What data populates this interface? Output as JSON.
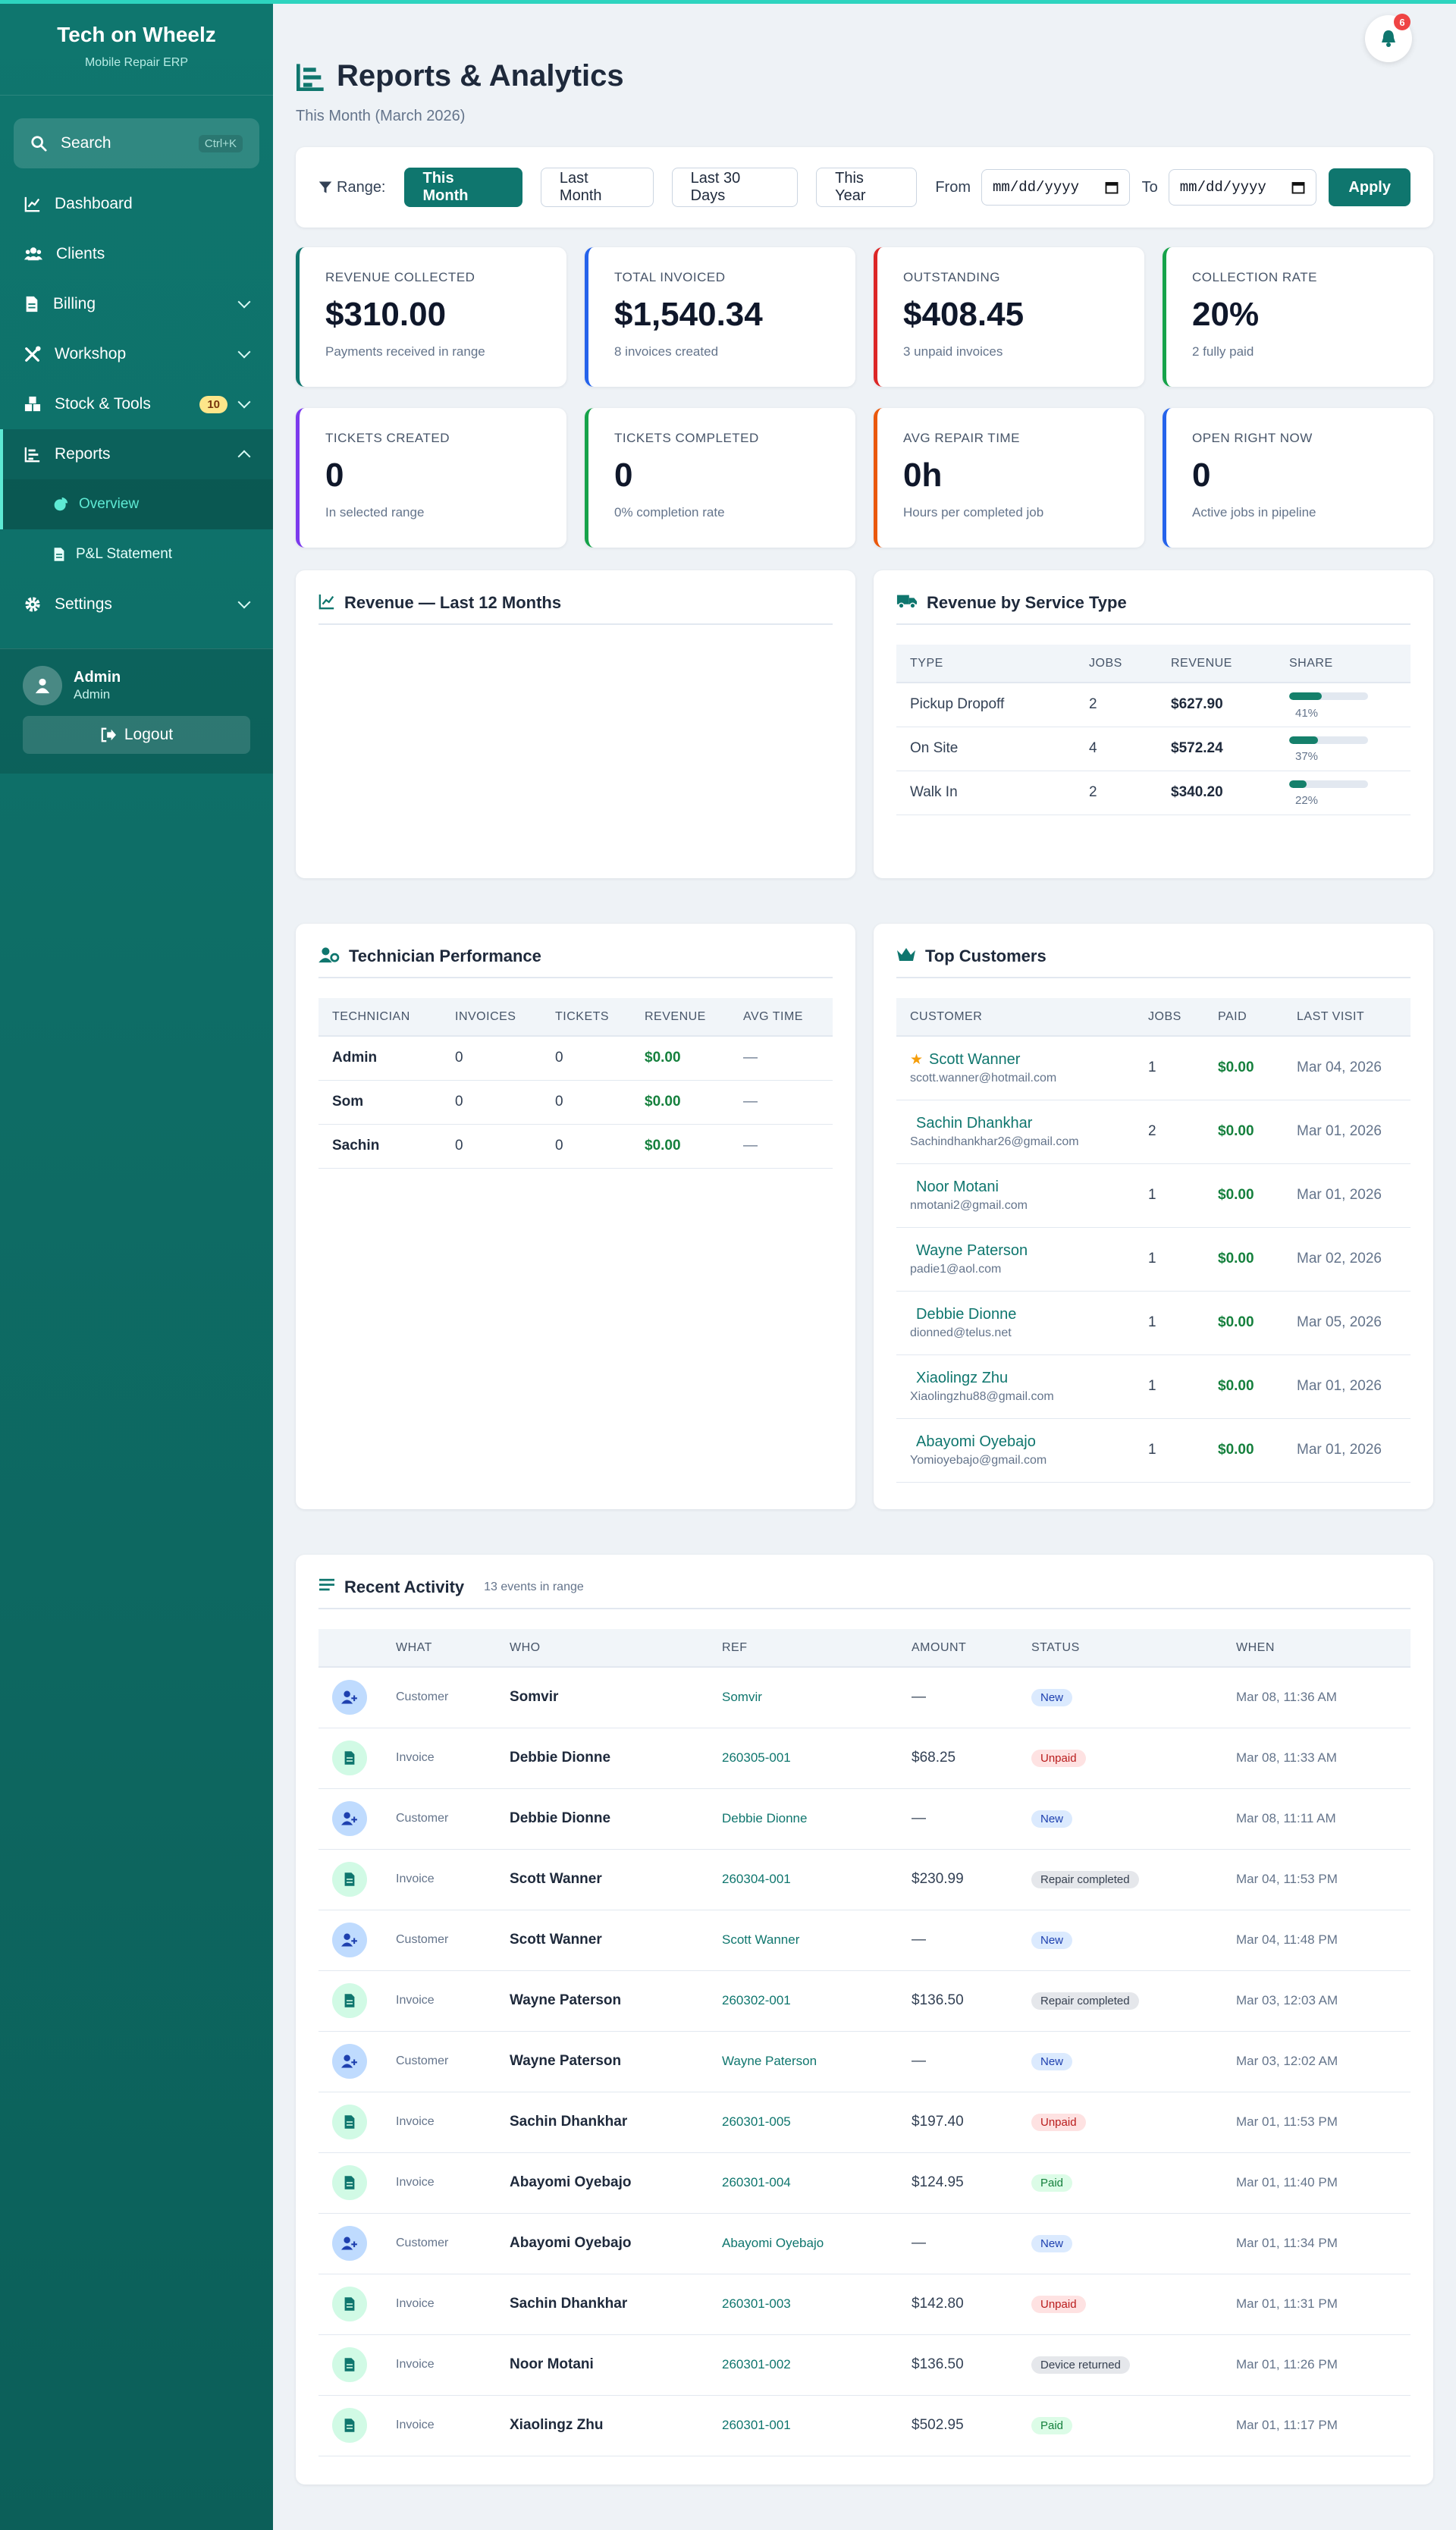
{
  "sidebar": {
    "brand_title": "Tech on Wheelz",
    "brand_sub": "Mobile Repair ERP",
    "search_label": "Search",
    "search_shortcut": "Ctrl+K",
    "nav": {
      "dashboard": "Dashboard",
      "clients": "Clients",
      "billing": "Billing",
      "workshop": "Workshop",
      "stock": "Stock & Tools",
      "stock_badge": "10",
      "reports": "Reports",
      "overview": "Overview",
      "pl": "P&L Statement",
      "settings": "Settings"
    },
    "user_name": "Admin",
    "user_role": "Admin",
    "logout": "Logout"
  },
  "header": {
    "title": "Reports & Analytics",
    "subtitle": "This Month (March 2026)",
    "bell_count": "6"
  },
  "filter": {
    "range_label": "Range:",
    "buttons": [
      "This Month",
      "Last Month",
      "Last 30 Days",
      "This Year"
    ],
    "active_button": "This Month",
    "from_label": "From",
    "to_label": "To",
    "date_placeholder": "mm/dd/yyyy",
    "apply": "Apply"
  },
  "stats": [
    {
      "label": "REVENUE COLLECTED",
      "value": "$310.00",
      "sub": "Payments received in range",
      "color": "#0f766e"
    },
    {
      "label": "TOTAL INVOICED",
      "value": "$1,540.34",
      "sub": "8 invoices created",
      "color": "#2563eb"
    },
    {
      "label": "OUTSTANDING",
      "value": "$408.45",
      "sub": "3 unpaid invoices",
      "color": "#dc2626"
    },
    {
      "label": "COLLECTION RATE",
      "value": "20%",
      "sub": "2 fully paid",
      "color": "#16a34a"
    },
    {
      "label": "TICKETS CREATED",
      "value": "0",
      "sub": "In selected range",
      "color": "#7c3aed"
    },
    {
      "label": "TICKETS COMPLETED",
      "value": "0",
      "sub": "0% completion rate",
      "color": "#16a34a"
    },
    {
      "label": "AVG REPAIR TIME",
      "value": "0h",
      "sub": "Hours per completed job",
      "color": "#ea580c"
    },
    {
      "label": "OPEN RIGHT NOW",
      "value": "0",
      "sub": "Active jobs in pipeline",
      "color": "#2563eb"
    }
  ],
  "revenue_chart": {
    "title": "Revenue — Last 12 Months"
  },
  "service": {
    "title": "Revenue by Service Type",
    "headers": [
      "TYPE",
      "JOBS",
      "REVENUE",
      "SHARE"
    ],
    "rows": [
      {
        "type": "Pickup Dropoff",
        "jobs": "2",
        "revenue": "$627.90",
        "share": "41%",
        "share_value": 41
      },
      {
        "type": "On Site",
        "jobs": "4",
        "revenue": "$572.24",
        "share": "37%",
        "share_value": 37
      },
      {
        "type": "Walk In",
        "jobs": "2",
        "revenue": "$340.20",
        "share": "22%",
        "share_value": 22
      }
    ]
  },
  "tech": {
    "title": "Technician Performance",
    "headers": [
      "TECHNICIAN",
      "INVOICES",
      "TICKETS",
      "REVENUE",
      "AVG TIME"
    ],
    "rows": [
      {
        "name": "Admin",
        "invoices": "0",
        "tickets": "0",
        "revenue": "$0.00",
        "avg": "—"
      },
      {
        "name": "Som",
        "invoices": "0",
        "tickets": "0",
        "revenue": "$0.00",
        "avg": "—"
      },
      {
        "name": "Sachin",
        "invoices": "0",
        "tickets": "0",
        "revenue": "$0.00",
        "avg": "—"
      }
    ]
  },
  "customers": {
    "title": "Top Customers",
    "headers": [
      "CUSTOMER",
      "JOBS",
      "PAID",
      "LAST VISIT"
    ],
    "rows": [
      {
        "name": "Scott Wanner",
        "email": "scott.wanner@hotmail.com",
        "jobs": "1",
        "paid": "$0.00",
        "last": "Mar 04, 2026",
        "star": "★"
      },
      {
        "name": "Sachin Dhankhar",
        "email": "Sachindhankhar26@gmail.com",
        "jobs": "2",
        "paid": "$0.00",
        "last": "Mar 01, 2026",
        "star": ""
      },
      {
        "name": "Noor Motani",
        "email": "nmotani2@gmail.com",
        "jobs": "1",
        "paid": "$0.00",
        "last": "Mar 01, 2026",
        "star": ""
      },
      {
        "name": "Wayne Paterson",
        "email": "padie1@aol.com",
        "jobs": "1",
        "paid": "$0.00",
        "last": "Mar 02, 2026",
        "star": ""
      },
      {
        "name": "Debbie Dionne",
        "email": "dionned@telus.net",
        "jobs": "1",
        "paid": "$0.00",
        "last": "Mar 05, 2026",
        "star": ""
      },
      {
        "name": "Xiaolingz Zhu",
        "email": "Xiaolingzhu88@gmail.com",
        "jobs": "1",
        "paid": "$0.00",
        "last": "Mar 01, 2026",
        "star": ""
      },
      {
        "name": "Abayomi Oyebajo",
        "email": "Yomioyebajo@gmail.com",
        "jobs": "1",
        "paid": "$0.00",
        "last": "Mar 01, 2026",
        "star": ""
      }
    ]
  },
  "activity": {
    "title": "Recent Activity",
    "count": "13 events in range",
    "headers": [
      "WHAT",
      "WHO",
      "REF",
      "AMOUNT",
      "STATUS",
      "WHEN"
    ],
    "rows": [
      {
        "kind": "Customer",
        "who": "Somvir",
        "ref": "Somvir",
        "amount": "—",
        "status": "New",
        "when": "Mar 08, 11:36 AM"
      },
      {
        "kind": "Invoice",
        "who": "Debbie Dionne",
        "ref": "260305-001",
        "amount": "$68.25",
        "status": "Unpaid",
        "when": "Mar 08, 11:33 AM"
      },
      {
        "kind": "Customer",
        "who": "Debbie Dionne",
        "ref": "Debbie Dionne",
        "amount": "—",
        "status": "New",
        "when": "Mar 08, 11:11 AM"
      },
      {
        "kind": "Invoice",
        "who": "Scott Wanner",
        "ref": "260304-001",
        "amount": "$230.99",
        "status": "Repair completed",
        "when": "Mar 04, 11:53 PM"
      },
      {
        "kind": "Customer",
        "who": "Scott Wanner",
        "ref": "Scott Wanner",
        "amount": "—",
        "status": "New",
        "when": "Mar 04, 11:48 PM"
      },
      {
        "kind": "Invoice",
        "who": "Wayne Paterson",
        "ref": "260302-001",
        "amount": "$136.50",
        "status": "Repair completed",
        "when": "Mar 03, 12:03 AM"
      },
      {
        "kind": "Customer",
        "who": "Wayne Paterson",
        "ref": "Wayne Paterson",
        "amount": "—",
        "status": "New",
        "when": "Mar 03, 12:02 AM"
      },
      {
        "kind": "Invoice",
        "who": "Sachin Dhankhar",
        "ref": "260301-005",
        "amount": "$197.40",
        "status": "Unpaid",
        "when": "Mar 01, 11:53 PM"
      },
      {
        "kind": "Invoice",
        "who": "Abayomi Oyebajo",
        "ref": "260301-004",
        "amount": "$124.95",
        "status": "Paid",
        "when": "Mar 01, 11:40 PM"
      },
      {
        "kind": "Customer",
        "who": "Abayomi Oyebajo",
        "ref": "Abayomi Oyebajo",
        "amount": "—",
        "status": "New",
        "when": "Mar 01, 11:34 PM"
      },
      {
        "kind": "Invoice",
        "who": "Sachin Dhankhar",
        "ref": "260301-003",
        "amount": "$142.80",
        "status": "Unpaid",
        "when": "Mar 01, 11:31 PM"
      },
      {
        "kind": "Invoice",
        "who": "Noor Motani",
        "ref": "260301-002",
        "amount": "$136.50",
        "status": "Device returned",
        "when": "Mar 01, 11:26 PM"
      },
      {
        "kind": "Invoice",
        "who": "Xiaolingz Zhu",
        "ref": "260301-001",
        "amount": "$502.95",
        "status": "Paid",
        "when": "Mar 01, 11:17 PM"
      }
    ]
  }
}
